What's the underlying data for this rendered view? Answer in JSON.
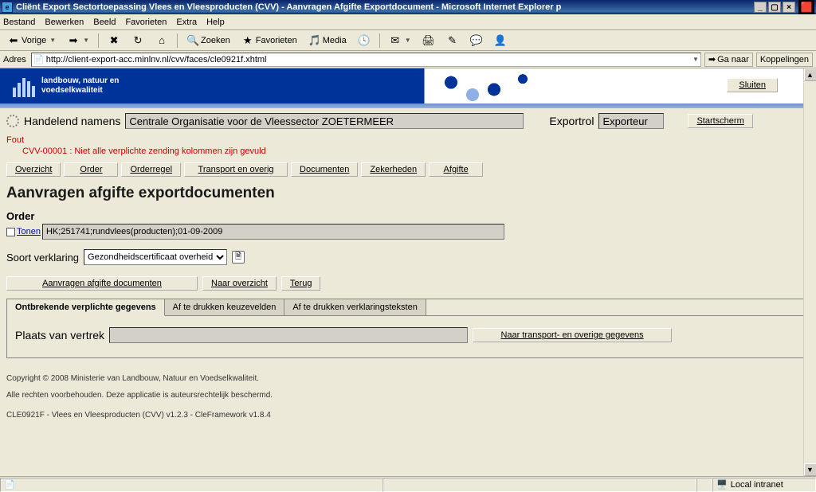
{
  "window": {
    "title": "Cliënt Export Sectortoepassing Vlees en Vleesproducten (CVV) - Aanvragen Afgifte Exportdocument - Microsoft Internet Explorer p"
  },
  "menubar": [
    "Bestand",
    "Bewerken",
    "Beeld",
    "Favorieten",
    "Extra",
    "Help"
  ],
  "toolbar": {
    "back": "Vorige",
    "search": "Zoeken",
    "favorites": "Favorieten",
    "media": "Media"
  },
  "addressbar": {
    "label": "Adres",
    "url": "http://client-export-acc.minlnv.nl/cvv/faces/cle0921f.xhtml",
    "go": "Ga naar",
    "links": "Koppelingen"
  },
  "banner": {
    "org_line1": "landbouw, natuur en",
    "org_line2": "voedselkwaliteit",
    "close": "Sluiten"
  },
  "filter": {
    "handelend_label": "Handelend namens",
    "handelend_value": "Centrale Organisatie voor de Vleessector ZOETERMEER",
    "exportrol_label": "Exportrol",
    "exportrol_value": "Exporteur",
    "startscherm": "Startscherm"
  },
  "error": {
    "head": "Fout",
    "msg": "CVV-00001 : Niet alle verplichte zending kolommen zijn gevuld"
  },
  "navtabs": {
    "overzicht": "Overzicht",
    "order": "Order",
    "orderregel": "Orderregel",
    "transport": "Transport en overig",
    "documenten": "Documenten",
    "zekerheden": "Zekerheden",
    "afgifte": "Afgifte"
  },
  "page_title": "Aanvragen afgifte exportdocumenten",
  "order": {
    "label": "Order",
    "tonen": "Tonen",
    "value": "HK;251741;rundvlees(producten);01-09-2009"
  },
  "soort": {
    "label": "Soort verklaring",
    "value": "Gezondheidscertificaat overheid"
  },
  "actions": {
    "aanvragen": "Aanvragen afgifte documenten",
    "naar_overzicht": "Naar overzicht",
    "terug": "Terug"
  },
  "tabs": {
    "t1": "Ontbrekende verplichte gegevens",
    "t2": "Af te drukken keuzevelden",
    "t3": "Af te drukken verklaringsteksten"
  },
  "panel": {
    "plaats_label": "Plaats van vertrek",
    "plaats_value": "",
    "naar_transport": "Naar transport- en overige gegevens"
  },
  "footer": {
    "copyright": "Copyright © 2008 Ministerie van Landbouw, Natuur en Voedselkwaliteit.",
    "rights": "Alle rechten voorbehouden. Deze applicatie is auteursrechtelijk beschermd.",
    "version": "CLE0921F - Vlees en Vleesproducten (CVV) v1.2.3 - CleFramework v1.8.4"
  },
  "statusbar": {
    "zone": "Local intranet"
  }
}
